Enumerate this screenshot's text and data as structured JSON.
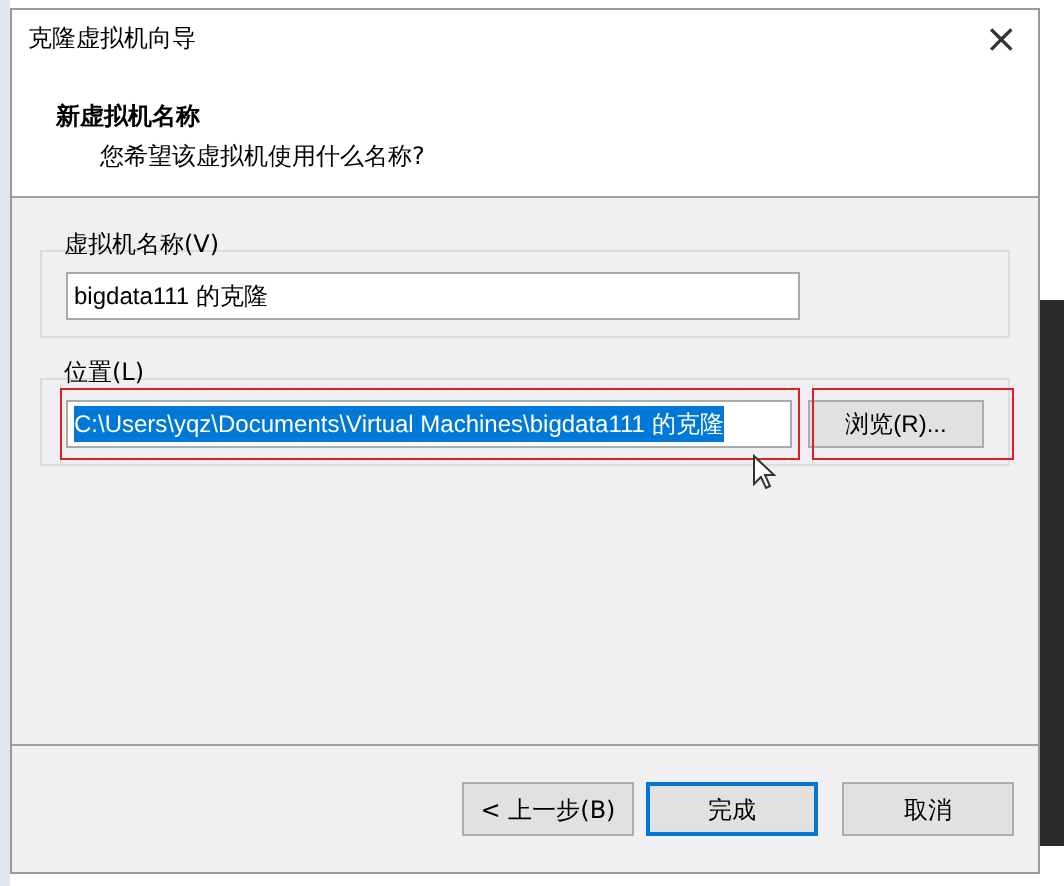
{
  "window": {
    "title": "克隆虚拟机向导",
    "close_glyph": "×"
  },
  "header": {
    "title": "新虚拟机名称",
    "subtitle": "您希望该虚拟机使用什么名称?"
  },
  "name_group": {
    "label": "虚拟机名称(V)",
    "value": "bigdata111 的克隆",
    "selected": false
  },
  "location_group": {
    "label": "位置(L)",
    "value": "C:\\Users\\yqz\\Documents\\Virtual Machines\\bigdata111 的克隆",
    "selected": true,
    "browse_button": "浏览(R)..."
  },
  "buttons": [
    {
      "label": "< 上一步(B)",
      "default": false
    },
    {
      "label": "完成",
      "default": true
    },
    {
      "label": "取消",
      "default": false
    }
  ]
}
